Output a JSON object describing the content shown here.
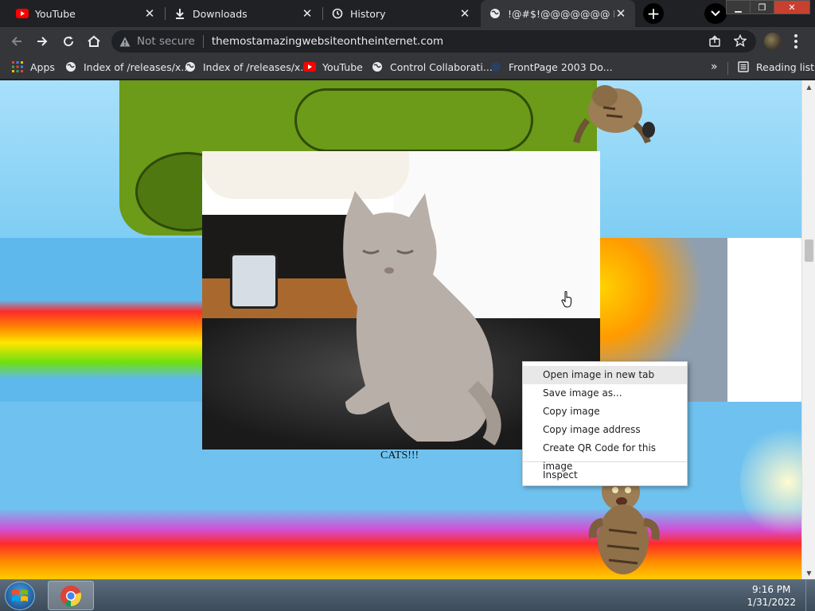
{
  "tabs": [
    {
      "title": "YouTube",
      "icon": "youtube-icon"
    },
    {
      "title": "Downloads",
      "icon": "download-icon"
    },
    {
      "title": "History",
      "icon": "history-icon"
    },
    {
      "title": "!@#$!@@@@@@@ MY",
      "icon": "globe-icon",
      "active": true
    }
  ],
  "toolbar": {
    "security_label": "Not secure",
    "url": "themostamazingwebsiteontheinternet.com"
  },
  "bookmarks": {
    "items": [
      {
        "label": "Apps",
        "icon": "apps-grid-icon"
      },
      {
        "label": "Index of /releases/x...",
        "icon": "globe-icon"
      },
      {
        "label": "Index of /releases/x...",
        "icon": "globe-icon"
      },
      {
        "label": "YouTube",
        "icon": "youtube-icon"
      },
      {
        "label": "Control Collaborati...",
        "icon": "globe-icon"
      },
      {
        "label": "FrontPage 2003 Do...",
        "icon": "frontpage-icon"
      }
    ],
    "more": "»",
    "reading_list": "Reading list"
  },
  "page": {
    "caption": "CATS!!!"
  },
  "context_menu": {
    "items": [
      "Open image in new tab",
      "Save image as...",
      "Copy image",
      "Copy image address",
      "Create QR Code for this image"
    ],
    "inspect": "Inspect"
  },
  "taskbar": {
    "time": "9:16 PM",
    "date": "1/31/2022"
  },
  "colors": {
    "chrome_dark": "#202124",
    "chrome_toolbar": "#35363a",
    "youtube_red": "#ff0000",
    "sky": "#8fd3f4"
  }
}
